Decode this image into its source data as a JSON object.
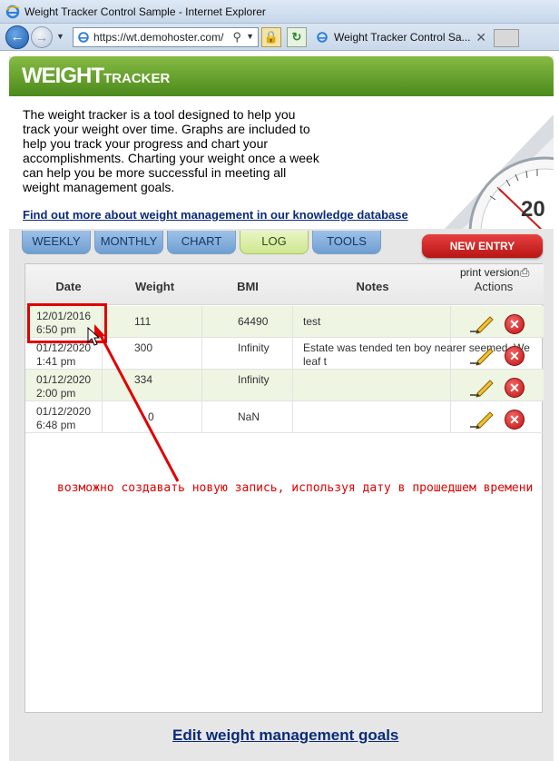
{
  "browser": {
    "window_title": "Weight Tracker Control Sample - Internet Explorer",
    "address": "https://wt.demohoster.com/",
    "tab_title": "Weight Tracker Control Sa..."
  },
  "banner": {
    "logo_big": "WEIGHT",
    "logo_small": "TRACKER"
  },
  "intro": {
    "text": "The weight tracker is a tool designed to help you track your weight over time. Graphs are included to help you track your progress and chart your accomplishments. Charting your weight once a week can help you be more successful in meeting all weight management goals.",
    "link": "Find out more about weight management in our knowledge database",
    "scale_number": "20"
  },
  "tabs": [
    "WEEKLY",
    "MONTHLY",
    "CHART",
    "LOG",
    "TOOLS"
  ],
  "active_tab": "LOG",
  "new_entry": "NEW ENTRY",
  "print_version": "print version",
  "table": {
    "headers": {
      "date": "Date",
      "weight": "Weight",
      "bmi": "BMI",
      "notes": "Notes",
      "actions": "Actions"
    },
    "rows": [
      {
        "date": "12/01/2016",
        "time": "6:50 pm",
        "weight": "111",
        "bmi": "64490",
        "notes": "test"
      },
      {
        "date": "01/12/2020",
        "time": "1:41 pm",
        "weight": "300",
        "bmi": "Infinity",
        "notes": "Estate was tended ten boy nearer seemed. We leaf t"
      },
      {
        "date": "01/12/2020",
        "time": "2:00 pm",
        "weight": "334",
        "bmi": "Infinity",
        "notes": ""
      },
      {
        "date": "01/12/2020",
        "time": "6:48 pm",
        "weight": "0",
        "bmi": "NaN",
        "notes": ""
      }
    ]
  },
  "annotation": "возможно создавать новую запись, используя дату в прошедшем времени",
  "goals_link": "Edit weight management goals",
  "colors": {
    "banner_green": "#5c9a28",
    "annotation_red": "#e00000",
    "link_blue": "#0a2a7a"
  }
}
